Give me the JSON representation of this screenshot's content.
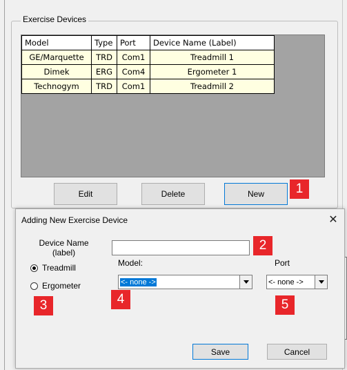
{
  "group": {
    "title": "Exercise Devices"
  },
  "grid": {
    "headers": [
      "Model",
      "Type",
      "Port",
      "Device Name (Label)"
    ],
    "rows": [
      [
        "GE/Marquette",
        "TRD",
        "Com1",
        "Treadmill 1"
      ],
      [
        "Dimek",
        "ERG",
        "Com4",
        "Ergometer 1"
      ],
      [
        "Technogym",
        "TRD",
        "Com1",
        "Treadmill 2"
      ]
    ]
  },
  "buttons": {
    "edit": "Edit",
    "delete": "Delete",
    "new": "New"
  },
  "badges": [
    "1",
    "2",
    "3",
    "4",
    "5"
  ],
  "badge_color": "#e8262a",
  "dialog": {
    "title": "Adding New Exercise Device",
    "close_glyph": "✕",
    "device_name_label_1": "Device Name",
    "device_name_label_2": "(label)",
    "device_name_value": "",
    "radio_treadmill": "Treadmill",
    "radio_ergometer": "Ergometer",
    "selected_type": "Treadmill",
    "model_label": "Model:",
    "model_value": "<- none ->",
    "port_label": "Port",
    "port_value": "<- none ->",
    "save": "Save",
    "cancel": "Cancel"
  }
}
